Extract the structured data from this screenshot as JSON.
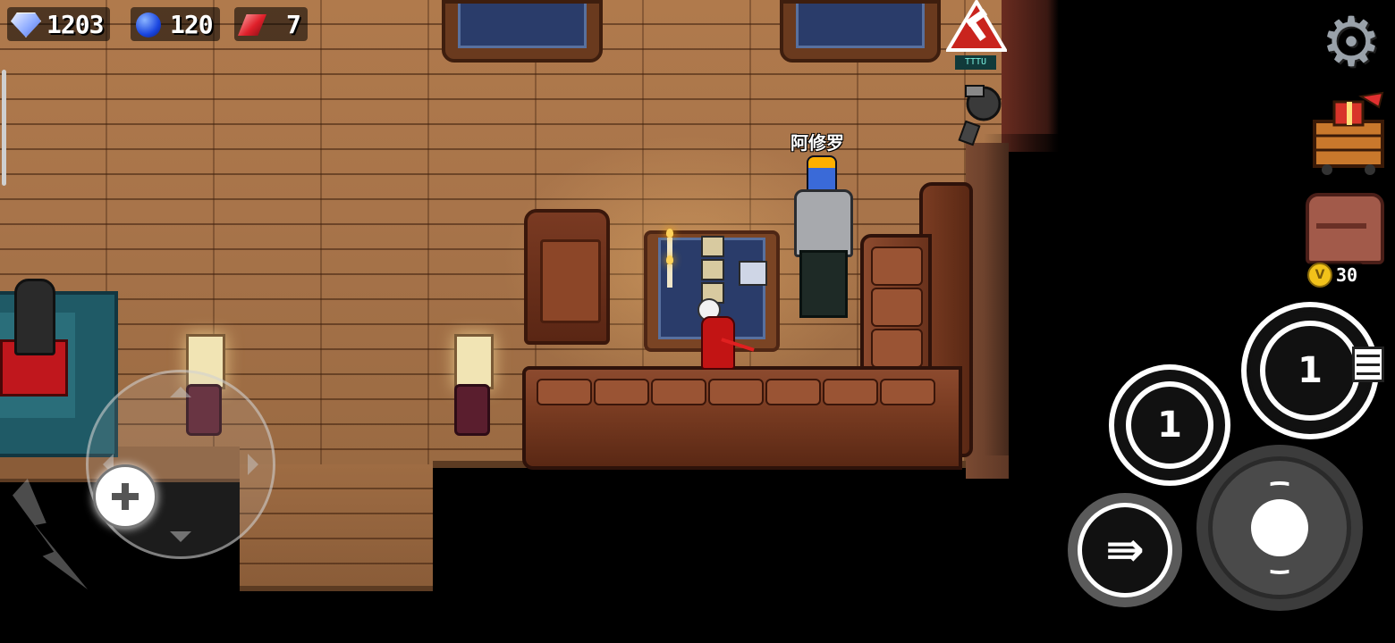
{
  "hud": {
    "diamonds": "1203",
    "blue_gems": "120",
    "red_gems": "7",
    "coins": "30",
    "coin_symbol": "V"
  },
  "npc": {
    "name": "阿修罗"
  },
  "sign": {
    "label": "TTTU"
  },
  "controls": {
    "skill_small_glyph": "1",
    "skill_big_glyph": "1",
    "dash_glyph": "⇛"
  },
  "icons": {
    "settings": "gear-icon",
    "shop": "gift-chest-icon",
    "inventory": "backpack-icon",
    "dash": "dash-icon",
    "attack": "attack-icon",
    "joystick": "dpad-icon",
    "alert": "hammer-warning-icon"
  },
  "colors": {
    "floor": "#a8744a",
    "sofa": "#7a3c22",
    "tablecloth": "#263a66",
    "npc_hair": "#ffb000",
    "npc_skin": "#3a6ad8",
    "hero_cloak": "#c21414"
  }
}
